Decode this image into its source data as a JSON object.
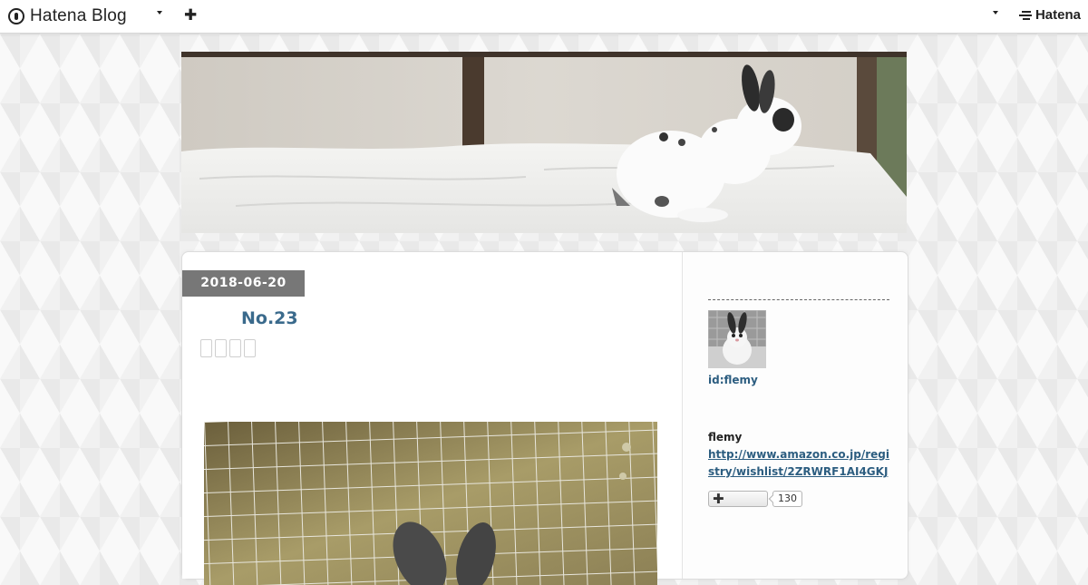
{
  "topbar": {
    "brand": "Hatena Blog",
    "right_brand": "Hatena",
    "add_icon": "plus-icon",
    "menu_icon": "caret-down-icon"
  },
  "entry": {
    "date": "2018-06-20",
    "title": "No.23"
  },
  "sidebar": {
    "user_id": "id:flemy",
    "name": "flemy",
    "link": "http://www.amazon.co.jp/registry/wishlist/2ZRWRF1AI4GKJ",
    "follow_icon": "plus-icon",
    "follower_count": "130"
  },
  "colors": {
    "title": "#3a6a8c",
    "link": "#2c5d80",
    "date_badge": "#777777"
  }
}
